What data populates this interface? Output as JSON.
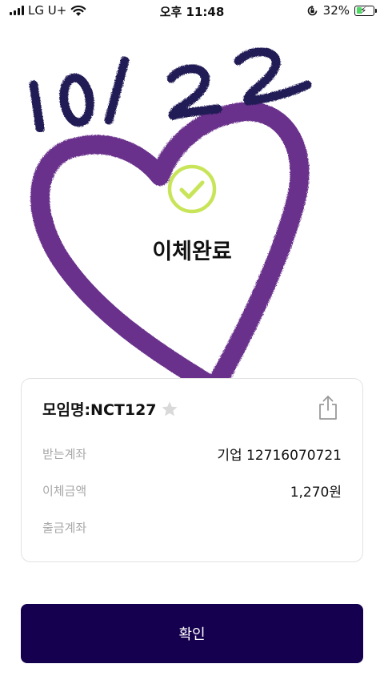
{
  "status_bar": {
    "carrier": "LG U+",
    "time": "오후 11:48",
    "battery_percent_label": "32%",
    "battery_level": 0.32
  },
  "handwriting": "10/22",
  "result": {
    "title": "이체완료"
  },
  "card": {
    "group_name": "모임명:NCT127",
    "rows": [
      {
        "label": "받는계좌",
        "value": "기업 12716070721"
      },
      {
        "label": "이체금액",
        "value": "1,270원"
      },
      {
        "label": "출금계좌",
        "value": ""
      }
    ]
  },
  "confirm_button": {
    "label": "확인"
  },
  "colors": {
    "heart": "#5e2384",
    "ink": "#231a56",
    "check": "#c8e55a",
    "button": "#15004f",
    "battery_fill": "#4cd964"
  }
}
